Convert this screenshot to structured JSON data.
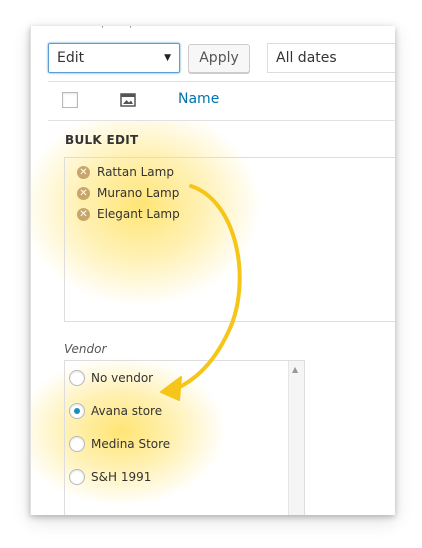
{
  "toolbar": {
    "action_select_value": "Edit",
    "apply_label": "Apply",
    "dates_select_value": "All dates"
  },
  "table_header": {
    "name_label": "Name"
  },
  "bulk_edit": {
    "title": "BULK EDIT",
    "items": [
      "Rattan Lamp",
      "Murano Lamp",
      "Elegant Lamp"
    ]
  },
  "vendor": {
    "label": "Vendor",
    "options": [
      {
        "label": "No vendor",
        "checked": false
      },
      {
        "label": "Avana store",
        "checked": true
      },
      {
        "label": "Medina Store",
        "checked": false
      },
      {
        "label": "S&H 1991",
        "checked": false
      }
    ]
  },
  "colors": {
    "link": "#0073aa",
    "highlight": "#f5c518",
    "radio_dot": "#1e8cbe",
    "remove_icon": "#c8a66a"
  }
}
